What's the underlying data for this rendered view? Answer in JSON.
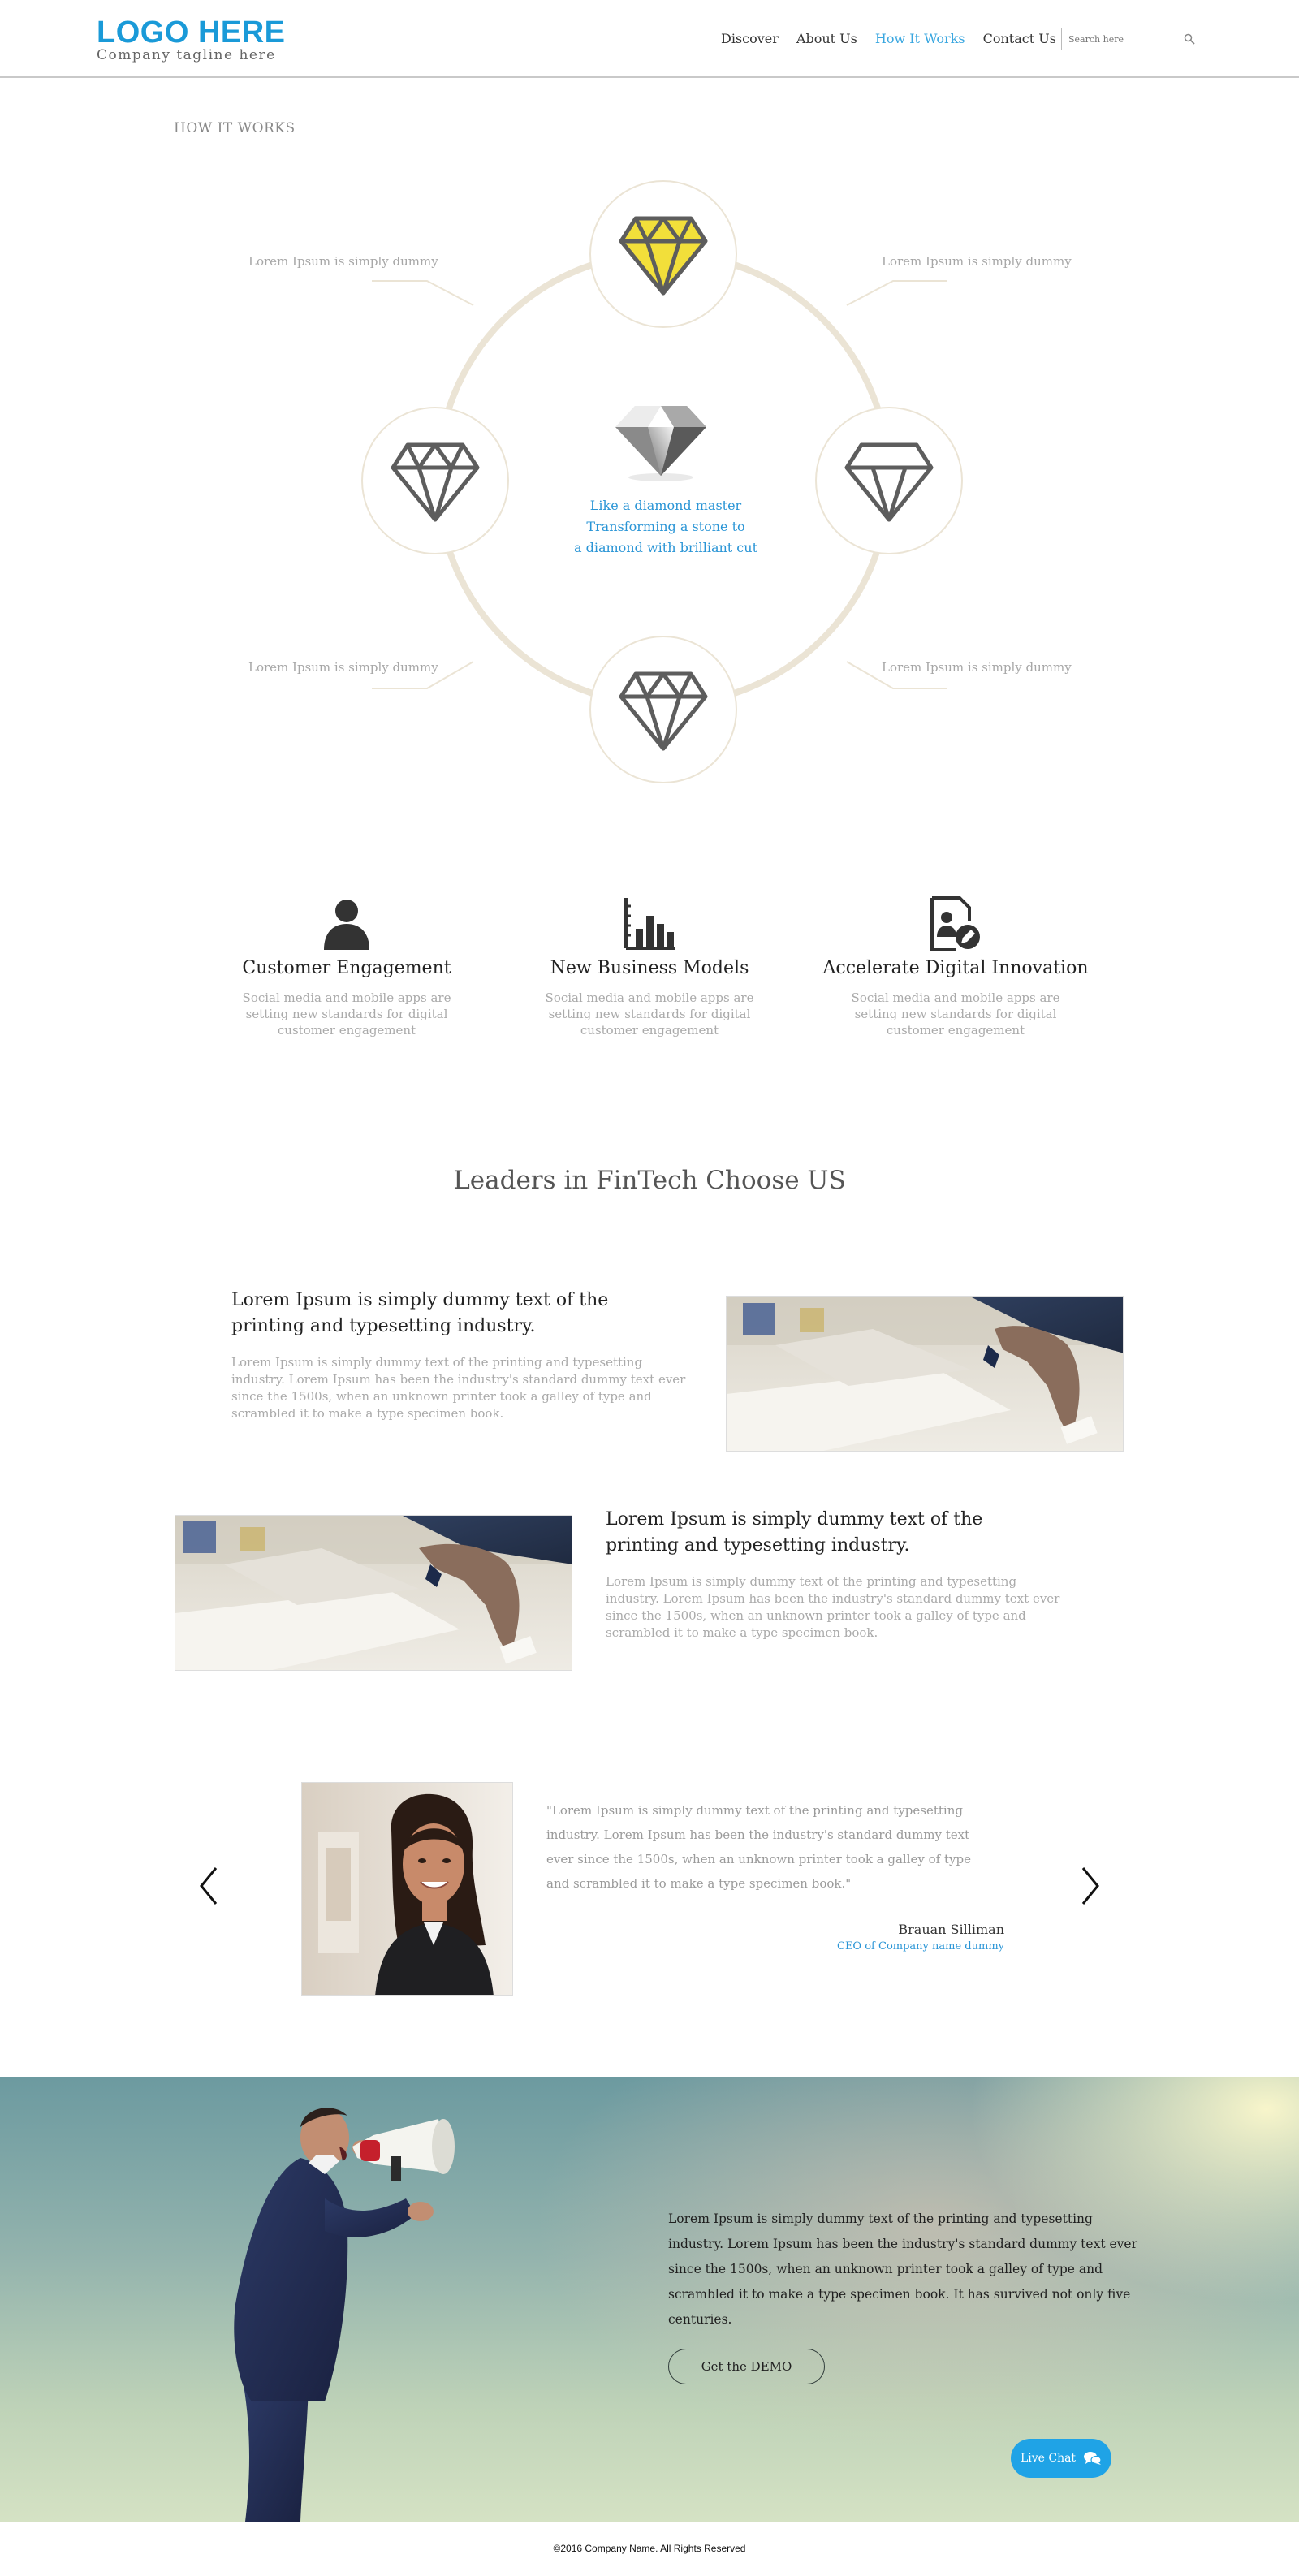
{
  "header": {
    "logo": "LOGO HERE",
    "tagline": "Company tagline here",
    "nav": [
      "Discover",
      "About Us",
      "How It Works",
      "Contact Us"
    ],
    "active_nav": "How It Works",
    "search_placeholder": "Search here"
  },
  "how_it_works": {
    "title": "HOW IT WORKS",
    "side_labels": [
      "Lorem Ipsum is simply dummy",
      "Lorem Ipsum is simply dummy",
      "Lorem Ipsum is simply dummy",
      "Lorem Ipsum is simply dummy"
    ],
    "center_lines": [
      "Like a diamond master",
      "Transforming a stone to",
      "a diamond with brilliant cut"
    ]
  },
  "features": [
    {
      "title": "Customer Engagement",
      "desc": "Social media and mobile apps are setting new standards for digital customer engagement",
      "icon": "person-icon"
    },
    {
      "title": "New Business Models",
      "desc": "Social media and mobile apps are setting new standards for digital customer engagement",
      "icon": "bar-chart-icon"
    },
    {
      "title": "Accelerate Digital Innovation",
      "desc": "Social media and mobile apps are setting new standards for digital customer engagement",
      "icon": "document-edit-icon"
    }
  ],
  "leaders": {
    "title": "Leaders in FinTech Choose US",
    "blocks": [
      {
        "title": "Lorem Ipsum is simply dummy text of the printing and typesetting industry.",
        "body": "Lorem Ipsum is simply dummy text of the printing and typesetting industry. Lorem Ipsum has been the industry's standard dummy text ever since the 1500s, when an unknown printer took a galley of type and scrambled it to make a type specimen book."
      },
      {
        "title": "Lorem Ipsum is simply dummy text of the printing and typesetting industry.",
        "body": "Lorem Ipsum is simply dummy text of the printing and typesetting industry. Lorem Ipsum has been the industry's standard dummy text ever since the 1500s, when an unknown printer took a galley of type and scrambled it to make a type specimen book."
      }
    ]
  },
  "testimonial": {
    "quote": "\"Lorem Ipsum is simply dummy text of the printing and typesetting industry. Lorem Ipsum has been the industry's standard dummy text ever since the 1500s, when an unknown printer took a galley of type and scrambled it to make a type specimen book.\"",
    "name": "Brauan Silliman",
    "role": "CEO of Company name dummy"
  },
  "hero": {
    "text": "Lorem Ipsum is simply dummy text of the printing and typesetting industry. Lorem Ipsum has been the industry's standard dummy text ever since the 1500s, when an unknown printer took a galley of type and scrambled it to make a type specimen book. It has survived not only five centuries.",
    "button": "Get the DEMO",
    "live_chat": "Live Chat"
  },
  "footer": {
    "copyright": "©2016 Company Name. All Rights Reserved"
  },
  "colors": {
    "accent": "#1a9ad8",
    "ring": "#ebe4d5",
    "gem_yellow": "#f2df3a"
  }
}
